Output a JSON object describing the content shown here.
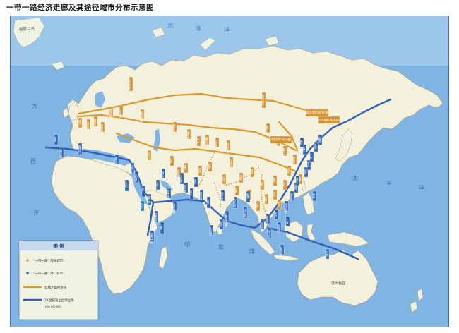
{
  "title": "一带一路经济走廊及其途径城市分布示意图",
  "colors": {
    "ocean": "#7fb4e3",
    "land": "#f3f0dc",
    "land_alt": "#eef3e2",
    "silk_road": "#d99a2b",
    "maritime": "#2f5fb8",
    "label_orange": "#d9922a",
    "label_blue": "#2c63b6"
  },
  "ocean_labels": {
    "north_1": "北",
    "north_2": "冰",
    "north_3": "洋",
    "atlantic_1": "大",
    "atlantic_2": "西",
    "atlantic_3": "洋",
    "pacific_1": "太",
    "pacific_2": "平",
    "pacific_3": "洋",
    "indian_1": "印",
    "indian_2": "度",
    "indian_3": "洋",
    "island_note": "格陵兰岛"
  },
  "legend": {
    "title": "图 例",
    "inland": "“一带一路” 内陆城市",
    "port": "“一带一路” 港口城市",
    "silk_road": "丝绸之路经济带",
    "maritime": "21世纪海上丝绸之路",
    "scale": "1:60 000 000"
  },
  "place_labels": {
    "australia": "澳大利亚"
  },
  "orange_boxes": [
    "乌兰巴托",
    "阿拉山口",
    "满洲里",
    "二连浩特",
    "霍尔果斯",
    "喀什",
    "瓜达尔",
    "德黑兰",
    "伊斯坦布尔",
    "莫斯科",
    "明斯克",
    "华沙",
    "鹿特丹",
    "杜伊斯堡",
    "阿拉木图",
    "塔什干",
    "比什凯克",
    "撒马尔罕",
    "伊斯兰堡",
    "拉合尔",
    "昆明",
    "西安",
    "兰州",
    "乌鲁木齐",
    "重庆",
    "成都",
    "郑州",
    "南宁",
    "曼谷",
    "仰光",
    "万象",
    "河内",
    "金边",
    "北京",
    "大连",
    "长春",
    "哈尔滨",
    "沈阳",
    "天津",
    "武汉"
  ],
  "callout_boxes": [
    "海拉尔铁路口岸(满洲里)",
    "绥芬河铁路口岸(绥芬河)",
    "珲春铁路口岸(珲春)"
  ],
  "blue_boxes": [
    "雅典",
    "威尼斯",
    "鹿特丹",
    "吉布提",
    "蒙巴萨",
    "达累斯萨拉姆",
    "亚丁",
    "吉达",
    "苏伊士",
    "塞得港",
    "比雷埃夫斯",
    "科伦坡",
    "皎漂",
    "吉大港",
    "加尔各答",
    "金奈",
    "孟买",
    "卡拉奇",
    "瓜达尔港",
    "马六甲",
    "新加坡",
    "雅加达",
    "吉隆坡",
    "关丹",
    "西哈努克",
    "胡志明",
    "海防",
    "湛江",
    "北海",
    "海口",
    "广州",
    "深圳",
    "香港",
    "厦门",
    "福州",
    "泉州",
    "宁波",
    "上海",
    "青岛",
    "大连港",
    "天津港",
    "马尼拉",
    "达尔文",
    "巴生",
    "汉班托塔",
    "马累",
    "马斯喀特",
    "阿巴斯",
    "迪拜",
    "苏丹港"
  ]
}
